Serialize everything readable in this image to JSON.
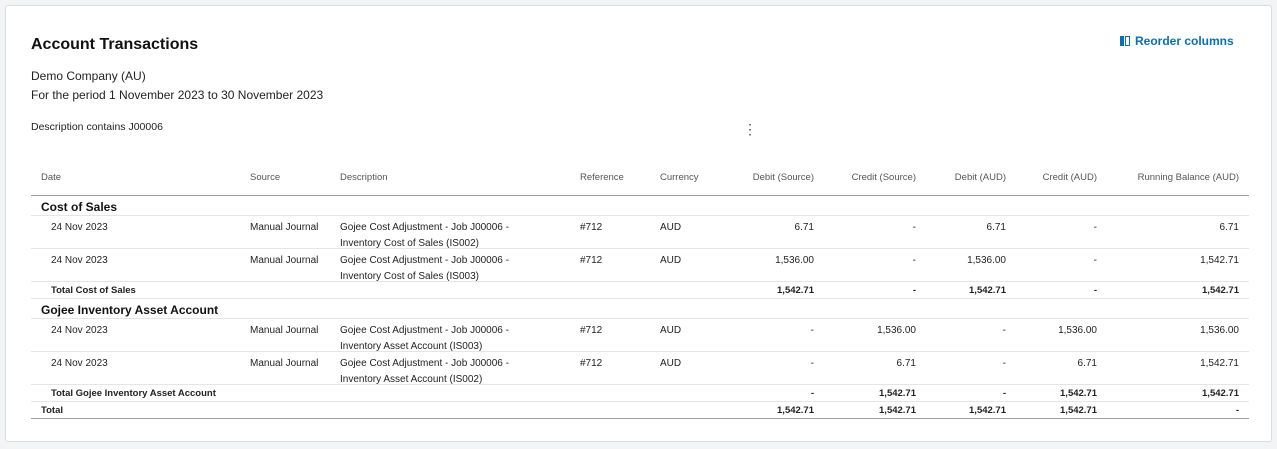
{
  "report": {
    "title": "Account Transactions",
    "company": "Demo Company (AU)",
    "period": "For the period 1 November 2023 to 30 November 2023",
    "filter": "Description contains J00006",
    "more_icon": "⋮",
    "reorder_label": "Reorder columns"
  },
  "columns": {
    "date": "Date",
    "source": "Source",
    "description": "Description",
    "reference": "Reference",
    "currency": "Currency",
    "debit_source": "Debit (Source)",
    "credit_source": "Credit (Source)",
    "debit_aud": "Debit (AUD)",
    "credit_aud": "Credit (AUD)",
    "running_balance": "Running Balance (AUD)"
  },
  "sections": [
    {
      "name": "Cost of Sales",
      "rows": [
        {
          "date": "24 Nov 2023",
          "source": "Manual Journal",
          "description": "Gojee Cost Adjustment - Job J00006 - Inventory Cost of Sales (IS002)",
          "reference": "#712",
          "currency": "AUD",
          "debit_source": "6.71",
          "credit_source": "-",
          "debit_aud": "6.71",
          "credit_aud": "-",
          "running_balance": "6.71"
        },
        {
          "date": "24 Nov 2023",
          "source": "Manual Journal",
          "description": "Gojee Cost Adjustment - Job J00006 - Inventory Cost of Sales (IS003)",
          "reference": "#712",
          "currency": "AUD",
          "debit_source": "1,536.00",
          "credit_source": "-",
          "debit_aud": "1,536.00",
          "credit_aud": "-",
          "running_balance": "1,542.71"
        }
      ],
      "total": {
        "label": "Total Cost of Sales",
        "debit_source": "1,542.71",
        "credit_source": "-",
        "debit_aud": "1,542.71",
        "credit_aud": "-",
        "running_balance": "1,542.71"
      }
    },
    {
      "name": "Gojee Inventory Asset Account",
      "rows": [
        {
          "date": "24 Nov 2023",
          "source": "Manual Journal",
          "description": "Gojee Cost Adjustment - Job J00006 - Inventory Asset Account (IS003)",
          "reference": "#712",
          "currency": "AUD",
          "debit_source": "-",
          "credit_source": "1,536.00",
          "debit_aud": "-",
          "credit_aud": "1,536.00",
          "running_balance": "1,536.00"
        },
        {
          "date": "24 Nov 2023",
          "source": "Manual Journal",
          "description": "Gojee Cost Adjustment - Job J00006 - Inventory Asset Account (IS002)",
          "reference": "#712",
          "currency": "AUD",
          "debit_source": "-",
          "credit_source": "6.71",
          "debit_aud": "-",
          "credit_aud": "6.71",
          "running_balance": "1,542.71"
        }
      ],
      "total": {
        "label": "Total Gojee Inventory Asset Account",
        "debit_source": "-",
        "credit_source": "1,542.71",
        "debit_aud": "-",
        "credit_aud": "1,542.71",
        "running_balance": "1,542.71"
      }
    }
  ],
  "grand_total": {
    "label": "Total",
    "debit_source": "1,542.71",
    "credit_source": "1,542.71",
    "debit_aud": "1,542.71",
    "credit_aud": "1,542.71",
    "running_balance": "-"
  },
  "colors": {
    "accent": "#0b6fb8"
  }
}
